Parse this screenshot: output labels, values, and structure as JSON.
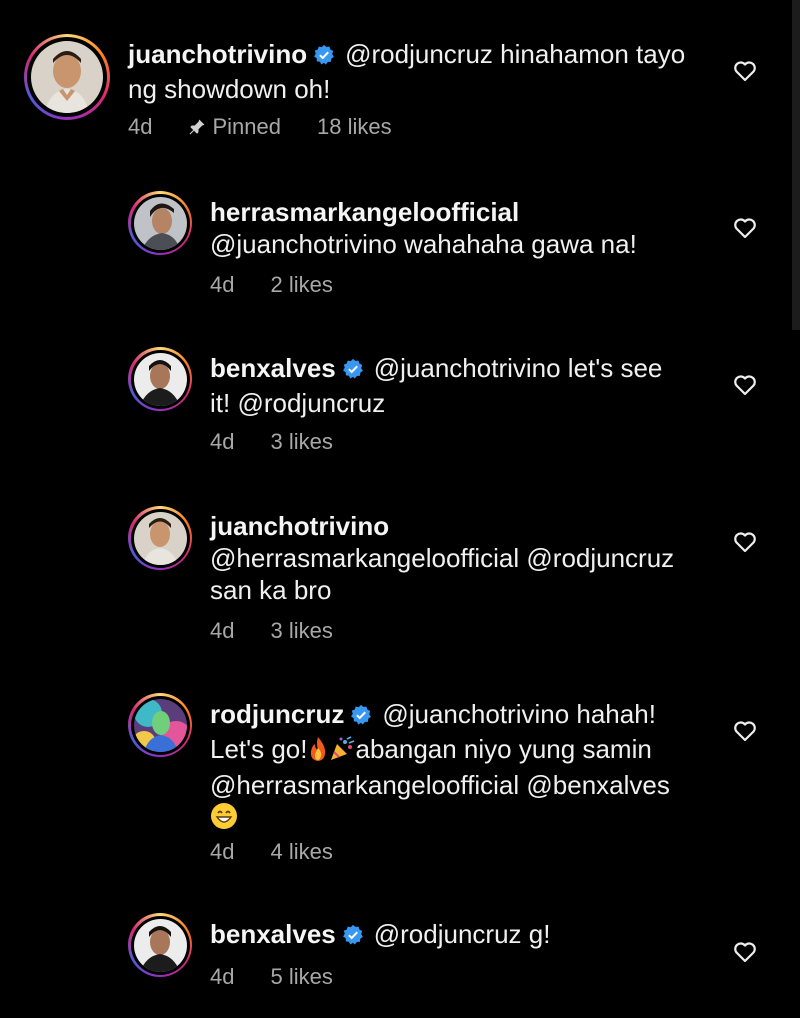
{
  "comments": [
    {
      "username": "juanchotrivino",
      "verified": true,
      "text_line1": "@rodjuncruz hinahamon tayo",
      "text_line2": "ng showdown oh!",
      "time": "4d",
      "pinned_label": "Pinned",
      "likes": "18 likes"
    },
    {
      "username": "herrasmarkangeloofficial",
      "verified": false,
      "text_line1": "@juanchotrivino wahahaha gawa na!",
      "time": "4d",
      "likes": "2 likes"
    },
    {
      "username": "benxalves",
      "verified": true,
      "text_line1": "@juanchotrivino let's see",
      "text_line2": "it! @rodjuncruz",
      "time": "4d",
      "likes": "3 likes"
    },
    {
      "username": "juanchotrivino",
      "verified": false,
      "text_line1": "@herrasmarkangeloofficial @rodjuncruz",
      "text_line2": "san ka bro",
      "time": "4d",
      "likes": "3 likes"
    },
    {
      "username": "rodjuncruz",
      "verified": true,
      "text_line1": "@juanchotrivino hahah!",
      "text_line2a": "Let's go!",
      "text_line2b": "abangan niyo yung samin",
      "text_line3": "@herrasmarkangeloofficial @benxalves",
      "time": "4d",
      "likes": "4 likes"
    },
    {
      "username": "benxalves",
      "verified": true,
      "text_line1": "@rodjuncruz g!",
      "time": "4d",
      "likes": "5 likes"
    }
  ],
  "icons": {
    "verified": "verified-badge-icon",
    "heart": "heart-outline-icon",
    "pin": "pin-icon",
    "fire": "fire-emoji",
    "party": "party-popper-emoji",
    "grin": "grinning-emoji"
  },
  "colors": {
    "background": "#000000",
    "verified_blue": "#3897f0",
    "meta_gray": "#a8a8a8"
  }
}
